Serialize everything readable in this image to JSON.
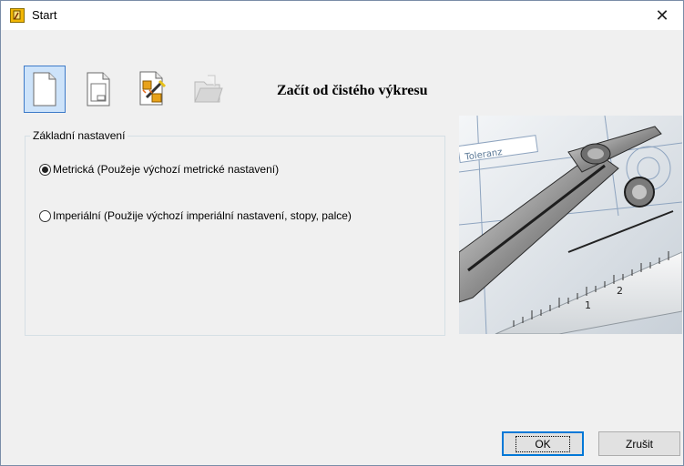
{
  "window": {
    "title": "Start",
    "close_glyph": "✕"
  },
  "toolbar": {
    "items": [
      {
        "name": "blank-drawing-icon",
        "selected": true,
        "enabled": true
      },
      {
        "name": "template-icon",
        "selected": false,
        "enabled": true
      },
      {
        "name": "wizard-icon",
        "selected": false,
        "enabled": true
      },
      {
        "name": "open-folder-icon",
        "selected": false,
        "enabled": false
      }
    ]
  },
  "heading": "Začít od čistého výkresu",
  "settings": {
    "legend": "Základní nastavení",
    "options": [
      {
        "label": "Metrická (Použeje výchozí metrické nastavení)",
        "checked": true
      },
      {
        "label": "Imperiální (Použije výchozí imperiální nastavení, stopy, palce)",
        "checked": false
      }
    ]
  },
  "photo": {
    "tag_text": "Toleranz",
    "ruler_numbers": [
      "1",
      "2"
    ]
  },
  "buttons": {
    "ok": "OK",
    "cancel": "Zrušit"
  },
  "colors": {
    "selection": "#cde3fa",
    "selection_border": "#3d7ac8",
    "dialog_bg": "#f0f0f0",
    "default_button_border": "#0078d7"
  }
}
